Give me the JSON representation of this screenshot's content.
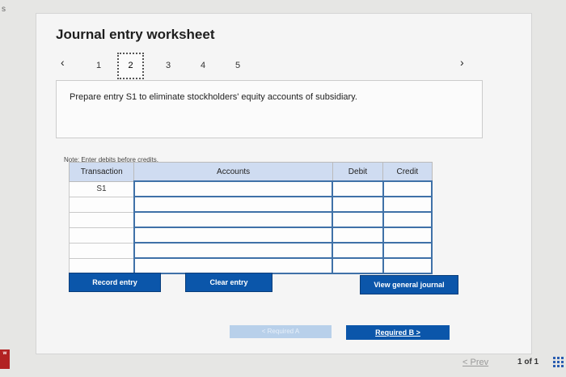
{
  "edge": {
    "left_text": "s",
    "badge_text": "w"
  },
  "worksheet": {
    "title": "Journal entry worksheet",
    "steps": [
      "1",
      "2",
      "3",
      "4",
      "5"
    ],
    "active_step": "2",
    "prev_icon": "chevron-left-icon",
    "next_icon": "chevron-right-icon",
    "instruction": "Prepare entry S1 to eliminate stockholders' equity accounts of subsidiary.",
    "note": "Note: Enter debits before credits."
  },
  "table": {
    "headers": [
      "Transaction",
      "Accounts",
      "Debit",
      "Credit"
    ],
    "rows": [
      {
        "transaction": "S1",
        "account": "",
        "debit": "",
        "credit": ""
      },
      {
        "transaction": "",
        "account": "",
        "debit": "",
        "credit": ""
      },
      {
        "transaction": "",
        "account": "",
        "debit": "",
        "credit": ""
      },
      {
        "transaction": "",
        "account": "",
        "debit": "",
        "credit": ""
      },
      {
        "transaction": "",
        "account": "",
        "debit": "",
        "credit": ""
      },
      {
        "transaction": "",
        "account": "",
        "debit": "",
        "credit": ""
      }
    ]
  },
  "buttons": {
    "record": "Record entry",
    "clear": "Clear entry",
    "view": "View general journal"
  },
  "navigation": {
    "required_a": "< Required A",
    "required_b": "Required B  >"
  },
  "footer": {
    "prev": "< Prev",
    "page_count": "1 of 1",
    "grid_icon": "grid-icon"
  },
  "colors": {
    "primary_button": "#0b56aa",
    "header_fill": "#cfdcf1",
    "input_border": "#3f71a8"
  }
}
